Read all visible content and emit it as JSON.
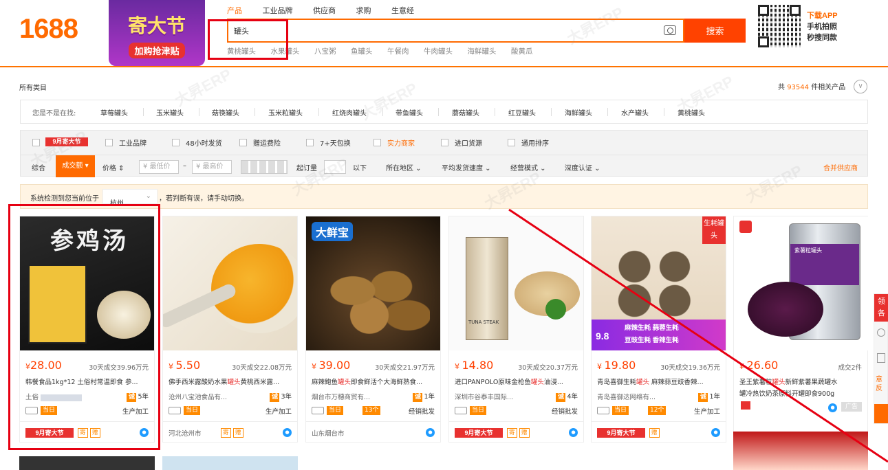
{
  "header": {
    "logo": "1688",
    "promo_title": "寄大节",
    "promo_sub": "加购抢津贴",
    "search_tabs": [
      "产品",
      "工业品牌",
      "供应商",
      "求购",
      "生意经"
    ],
    "search_value": "罐头",
    "search_button": "搜索",
    "hot_words": [
      "黄桃罐头",
      "水果罐头",
      "八宝粥",
      "鱼罐头",
      "午餐肉",
      "牛肉罐头",
      "海鲜罐头",
      "酸黄瓜"
    ],
    "app_lines": [
      "下载APP",
      "手机拍照",
      "秒搜同款"
    ]
  },
  "results": {
    "all_category": "所有类目",
    "count_prefix": "共",
    "count": "93544",
    "count_suffix": "件相关产品",
    "circle": "∨"
  },
  "related": {
    "label": "您是不是在找:",
    "items": [
      "草莓罐头",
      "玉米罐头",
      "菇筷罐头",
      "玉米粒罐头",
      "红烧肉罐头",
      "带鱼罐头",
      "蘑菇罐头",
      "红豆罐头",
      "海鲜罐头",
      "水产罐头",
      "黄桃罐头"
    ]
  },
  "filters": {
    "badge": "9月寄大节",
    "checks": [
      "工业品牌",
      "48小时发货",
      "赠运费险",
      "7+天包换",
      "实力商家",
      "进口货源",
      "通用排序"
    ],
    "sort": [
      "综合",
      "成交额",
      "价格"
    ],
    "price_min": "¥ 最低价",
    "price_max": "¥ 最高价",
    "dash": "–",
    "start_qty": "起订量",
    "below": "以下",
    "dropdowns": [
      "所在地区",
      "平均发货速度",
      "经营模式",
      "深度认证"
    ],
    "merge": "合并供应商"
  },
  "location": {
    "prefix": "系统检测到您当前位于",
    "city": "杭州",
    "suffix": "，若判断有误，请手动切换。"
  },
  "products": [
    {
      "price": "28.00",
      "sold": "30天成交39.96万元",
      "title_pre": "韩餐食品1kg*12 土俗村常温即食 参...",
      "title_hl": "",
      "title_post": "",
      "shop": "土俗",
      "years": "5年",
      "today": "当日",
      "mode": "生产加工",
      "city": "",
      "tags": [
        "9月寄大节",
        "寄",
        "赠"
      ],
      "label": "参鸡汤"
    },
    {
      "price": "5.50",
      "sold": "30天成交22.08万元",
      "title_pre": "佛手西米露酸奶水果",
      "title_hl": "罐头",
      "title_post": "黄桃西米露...",
      "shop": "沧州八宝池食品有...",
      "years": "3年",
      "today": "当日",
      "mode": "生产加工",
      "city": "河北沧州市",
      "tags": [
        "寄",
        "赠"
      ],
      "label": ""
    },
    {
      "price": "39.00",
      "sold": "30天成交21.97万元",
      "title_pre": "麻辣鲍鱼",
      "title_hl": "罐头",
      "title_post": "即食鲜活个大海鲜熟食...",
      "shop": "烟台市万穗商贸有...",
      "years": "1年",
      "today": "当日",
      "mode": "经销批发",
      "city": "山东烟台市",
      "tags": [],
      "label": "大鲜宝",
      "badge": "13个"
    },
    {
      "price": "14.80",
      "sold": "30天成交20.37万元",
      "title_pre": "进口PANPOLO原味金枪鱼",
      "title_hl": "罐头",
      "title_post": "油浸...",
      "shop": "深圳市谷泰丰国际...",
      "years": "4年",
      "today": "当日",
      "mode": "经销批发",
      "city": "",
      "tags": [
        "9月寄大节",
        "寄",
        "赠"
      ],
      "label": "TUNA STEAK"
    },
    {
      "price": "19.80",
      "sold": "30天成交19.36万元",
      "title_pre": "青岛喜御生耗",
      "title_hl": "罐头",
      "title_post": " 麻辣蒜豆豉香辣...",
      "shop": "青岛喜御达网络有...",
      "years": "1年",
      "today": "当日",
      "mode": "生产加工",
      "city": "",
      "tags": [
        "9月寄大节",
        "赠"
      ],
      "label": "生耗罐头",
      "badge": "12个",
      "sub1": "麻辣生耗  蒜蓉生耗",
      "sub2": "豆豉生耗  香辣生耗",
      "deal": "9.8"
    },
    {
      "price": "26.60",
      "sold": "成交2件",
      "title_pre": "圣王紫薯粒",
      "title_hl": "罐头",
      "title_post": "新鲜紫薯果蔬罐水",
      "title2": "罐冷热饮奶茶原料开罐即食900g",
      "shop": "",
      "years": "",
      "today": "",
      "mode": "",
      "city": "",
      "tags": [],
      "label": "紫薯粒罐头",
      "ad": "广告"
    }
  ],
  "side": {
    "text": "领 各",
    "text2": "意 反"
  },
  "watermark": "大昇ERP",
  "colors": {
    "brand": "#ff6a00",
    "highlight": "#e60012",
    "price": "#ff4000"
  }
}
